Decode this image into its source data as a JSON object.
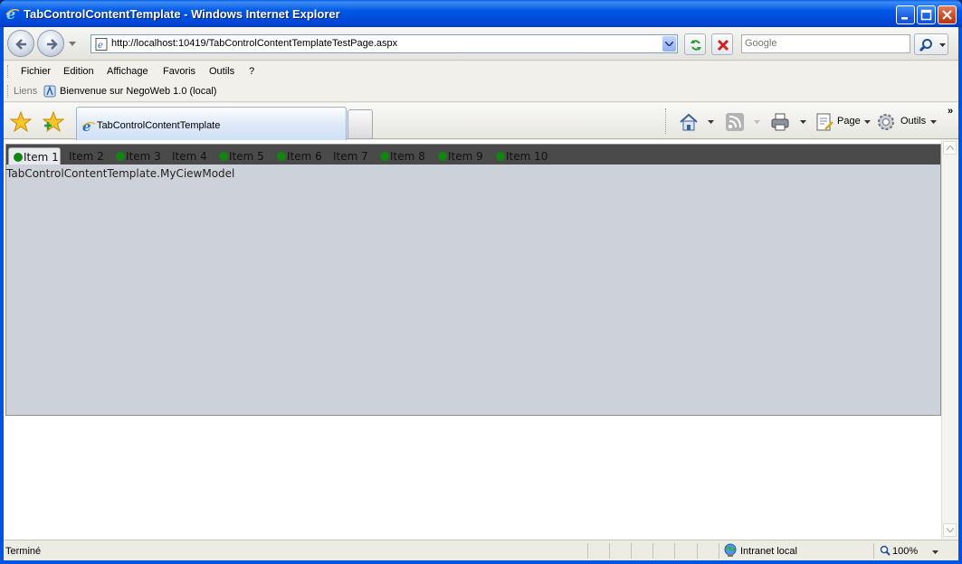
{
  "window": {
    "title": "TabControlContentTemplate - Windows Internet Explorer"
  },
  "address": {
    "url": "http://localhost:10419/TabControlContentTemplateTestPage.aspx"
  },
  "search": {
    "placeholder": "Google"
  },
  "menu": {
    "items": [
      {
        "label": "Fichier"
      },
      {
        "label": "Edition"
      },
      {
        "label": "Affichage"
      },
      {
        "label": "Favoris"
      },
      {
        "label": "Outils"
      },
      {
        "label": "?"
      }
    ]
  },
  "links": {
    "label": "Liens",
    "items": [
      {
        "label": "Bienvenue sur NegoWeb 1.0 (local)"
      }
    ]
  },
  "browser_tab": {
    "label": "TabControlContentTemplate"
  },
  "commands": {
    "page_label": "Page",
    "tools_label": "Outils",
    "overflow": "»"
  },
  "content": {
    "tabs": [
      {
        "label": "Item 1",
        "has_icon": true,
        "selected": true
      },
      {
        "label": "Item 2",
        "has_icon": false,
        "selected": false
      },
      {
        "label": "Item 3",
        "has_icon": true,
        "selected": false
      },
      {
        "label": "Item 4",
        "has_icon": false,
        "selected": false
      },
      {
        "label": "Item 5",
        "has_icon": true,
        "selected": false
      },
      {
        "label": "Item 6",
        "has_icon": true,
        "selected": false
      },
      {
        "label": "Item 7",
        "has_icon": false,
        "selected": false
      },
      {
        "label": "Item 8",
        "has_icon": true,
        "selected": false
      },
      {
        "label": "Item 9",
        "has_icon": true,
        "selected": false
      },
      {
        "label": "Item 10",
        "has_icon": true,
        "selected": false
      }
    ],
    "body_text": "TabControlContentTemplate.MyCiewModel",
    "colors": {
      "tab_icon": "#118411",
      "tabstrip": "#4a4a4a",
      "panel": "#cdd1da"
    }
  },
  "status": {
    "text": "Terminé",
    "zone": "Intranet local",
    "zoom": "100%"
  }
}
